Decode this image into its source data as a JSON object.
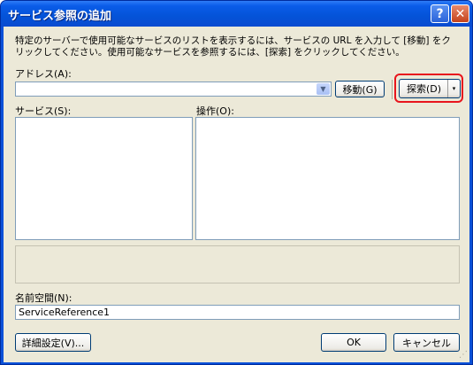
{
  "window": {
    "title": "サービス参照の追加",
    "help_glyph": "?",
    "close_glyph": "✕"
  },
  "description": "特定のサーバーで使用可能なサービスのリストを表示するには、サービスの URL を入力して [移動] をクリックしてください。使用可能なサービスを参照するには、[探索] をクリックしてください。",
  "address": {
    "label": "アドレス(A):",
    "value": "",
    "dropdown_glyph": "▼"
  },
  "go_button": {
    "label": "移動(G)"
  },
  "discover_button": {
    "label": "探索(D)",
    "arrow_glyph": "▾"
  },
  "services": {
    "label": "サービス(S):",
    "items": []
  },
  "operations": {
    "label": "操作(O):",
    "items": []
  },
  "namespace": {
    "label": "名前空間(N):",
    "value": "ServiceReference1"
  },
  "advanced_button": {
    "label": "詳細設定(V)..."
  },
  "ok_button": {
    "label": "OK"
  },
  "cancel_button": {
    "label": "キャンセル"
  },
  "grip_glyph": "⋰",
  "colors": {
    "titlebar": "#0a5ce8",
    "dialog_bg": "#ece9d8",
    "highlight": "#e8151d",
    "field_border": "#7f9db9"
  },
  "icons": {
    "help": "help-icon",
    "close": "close-icon",
    "dropdown": "chevron-down-icon",
    "split": "split-arrow-icon",
    "grip": "resize-grip-icon"
  }
}
